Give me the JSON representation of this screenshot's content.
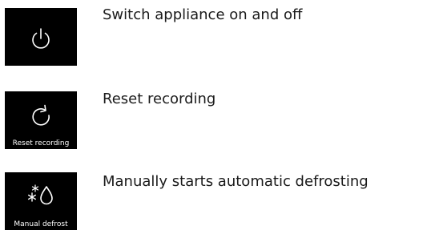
{
  "items": [
    {
      "icon": "power-icon",
      "caption": "",
      "description": "Switch appliance on and off"
    },
    {
      "icon": "reset-arrow-icon",
      "caption": "Reset recording",
      "description": "Reset recording"
    },
    {
      "icon": "defrost-icon",
      "caption": "Manual defrost",
      "description": "Manually starts automatic defrosting"
    }
  ],
  "colors": {
    "tile_background": "#000000",
    "tile_foreground": "#ffffff",
    "text": "#1a1a1a"
  }
}
